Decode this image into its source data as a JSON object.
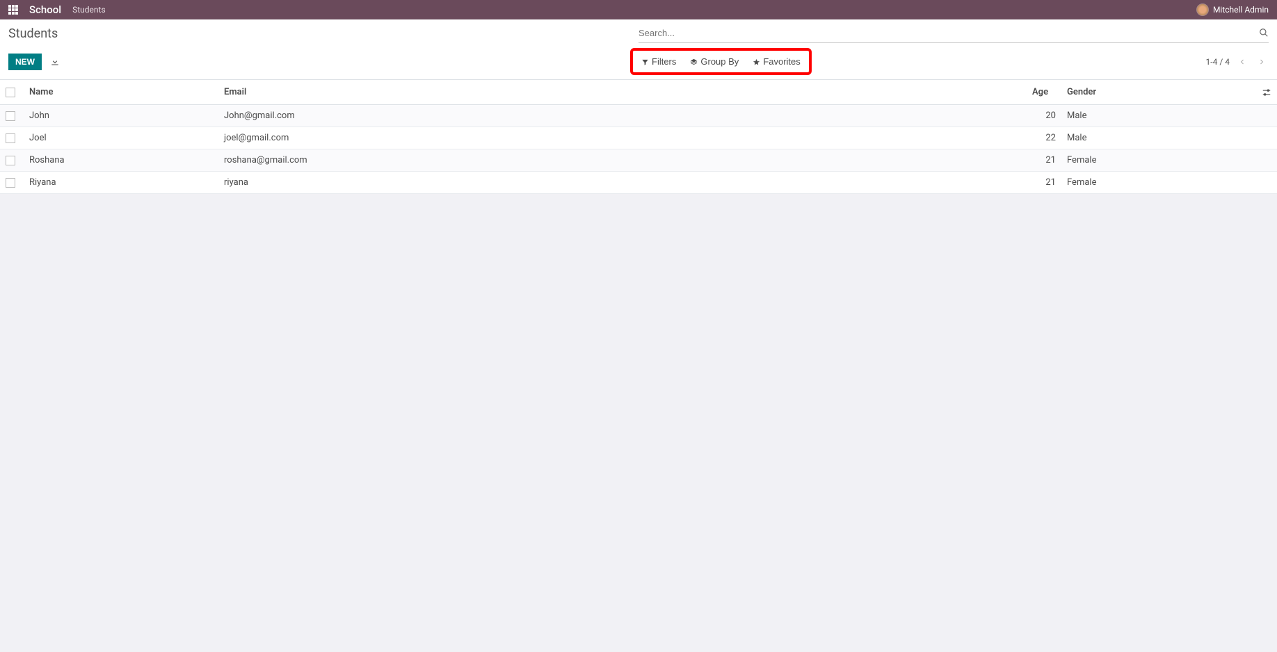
{
  "topbar": {
    "brand": "School",
    "menu_item": "Students",
    "username": "Mitchell Admin"
  },
  "control": {
    "title": "Students",
    "search_placeholder": "Search...",
    "new_label": "NEW",
    "filters_label": "Filters",
    "groupby_label": "Group By",
    "favorites_label": "Favorites",
    "pager": "1-4 / 4"
  },
  "table": {
    "headers": {
      "name": "Name",
      "email": "Email",
      "age": "Age",
      "gender": "Gender"
    },
    "rows": [
      {
        "name": "John",
        "email": "John@gmail.com",
        "age": "20",
        "gender": "Male"
      },
      {
        "name": "Joel",
        "email": "joel@gmail.com",
        "age": "22",
        "gender": "Male"
      },
      {
        "name": "Roshana",
        "email": "roshana@gmail.com",
        "age": "21",
        "gender": "Female"
      },
      {
        "name": "Riyana",
        "email": "riyana",
        "age": "21",
        "gender": "Female"
      }
    ]
  }
}
